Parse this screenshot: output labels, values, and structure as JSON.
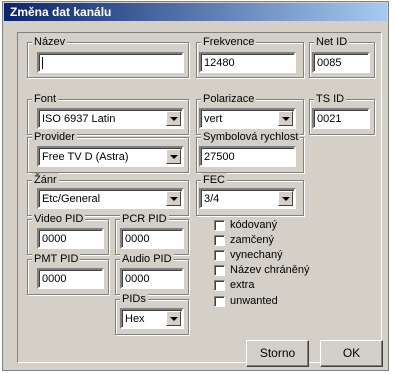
{
  "dialog": {
    "title": "Změna dat kanálu"
  },
  "fields": {
    "nazev": {
      "label": "Název",
      "value": ""
    },
    "frekvence": {
      "label": "Frekvence",
      "value": "12480"
    },
    "net_id": {
      "label": "Net ID",
      "value": "0085"
    },
    "font": {
      "label": "Font",
      "value": "ISO 6937 Latin"
    },
    "polarizace": {
      "label": "Polarizace",
      "value": "vert"
    },
    "ts_id": {
      "label": "TS ID",
      "value": "0021"
    },
    "provider": {
      "label": "Provider",
      "value": "Free TV D (Astra)"
    },
    "symbolova": {
      "label": "Symbolová rychlost",
      "value": "27500"
    },
    "zanr": {
      "label": "Žánr",
      "value": "Etc/General"
    },
    "fec": {
      "label": "FEC",
      "value": "3/4"
    },
    "video_pid": {
      "label": "Video PID",
      "value": "0000"
    },
    "pcr_pid": {
      "label": "PCR PID",
      "value": "0000"
    },
    "pmt_pid": {
      "label": "PMT PID",
      "value": "0000"
    },
    "audio_pid": {
      "label": "Audio PID",
      "value": "0000"
    },
    "pids": {
      "label": "PIDs",
      "value": "Hex"
    }
  },
  "checkboxes": [
    {
      "label": "kódovaný",
      "checked": false
    },
    {
      "label": "zamčený",
      "checked": false
    },
    {
      "label": "vynechaný",
      "checked": false
    },
    {
      "label": "Název chráněný",
      "checked": false
    },
    {
      "label": "extra",
      "checked": false
    },
    {
      "label": "unwanted",
      "checked": false
    }
  ],
  "buttons": {
    "cancel": "Storno",
    "ok": "OK"
  }
}
